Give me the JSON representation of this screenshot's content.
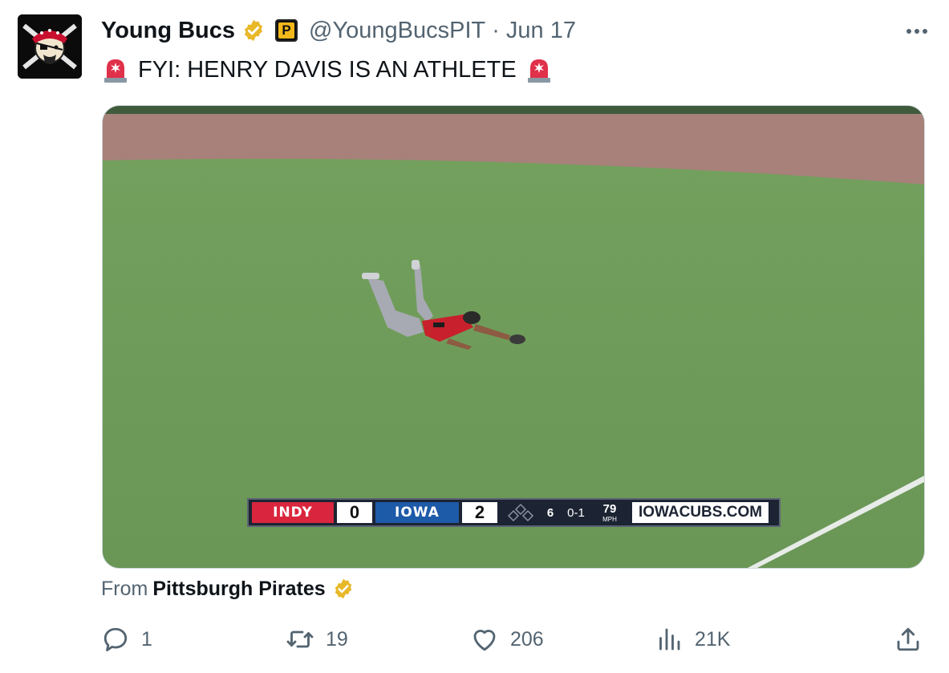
{
  "tweet": {
    "display_name": "Young Bucs",
    "affiliate_badge_letter": "P",
    "handle": "@YoungBucsPIT",
    "separator": "·",
    "date": "Jun 17",
    "text": "FYI: HENRY DAVIS IS AN ATHLETE",
    "leading_emoji": "siren-icon",
    "trailing_emoji": "siren-icon"
  },
  "media": {
    "scorebug": {
      "away_team": "INDY",
      "away_score": "0",
      "home_team": "IOWA",
      "home_score": "2",
      "inning": "6",
      "count": "0-1",
      "pitch_speed": "79",
      "speed_unit": "MPH",
      "site": "IOWACUBS.COM"
    }
  },
  "source": {
    "prefix": "From",
    "name": "Pittsburgh Pirates"
  },
  "actions": {
    "replies": "1",
    "retweets": "19",
    "likes": "206",
    "views": "21K"
  },
  "colors": {
    "verified_gold": "#e8b829",
    "text_primary": "#0f1419",
    "text_secondary": "#536471"
  }
}
